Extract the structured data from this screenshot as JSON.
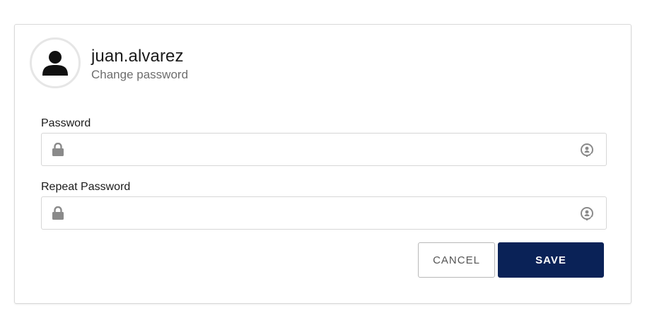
{
  "profile": {
    "username": "juan.alvarez",
    "subtitle": "Change password",
    "avatar_icon": "user-icon"
  },
  "form": {
    "password": {
      "label": "Password",
      "value": "",
      "placeholder": "",
      "leading_icon": "lock-icon",
      "trailing_icon": "toggle-visibility-icon"
    },
    "repeat_password": {
      "label": "Repeat Password",
      "value": "",
      "placeholder": "",
      "leading_icon": "lock-icon",
      "trailing_icon": "toggle-visibility-icon"
    }
  },
  "actions": {
    "cancel_label": "CANCEL",
    "save_label": "SAVE"
  },
  "colors": {
    "primary": "#0a2257",
    "border": "#d6d6d6",
    "icon": "#8a8a8a",
    "subtitle": "#6e6e6e"
  }
}
